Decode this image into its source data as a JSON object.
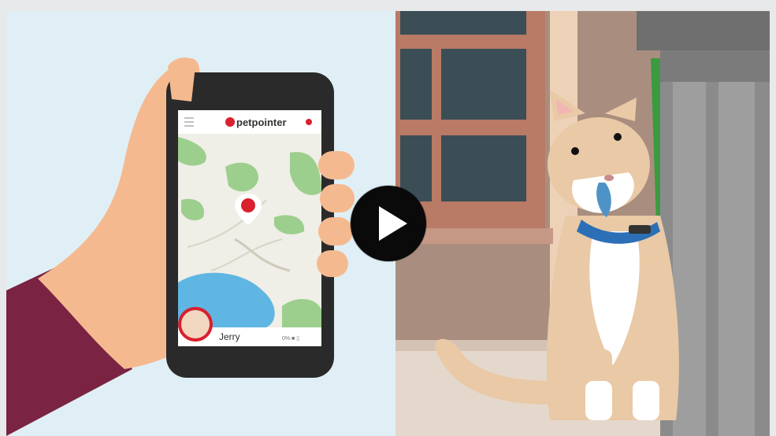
{
  "video": {
    "player_label": "Video player",
    "play_label": "Play video"
  },
  "app": {
    "brand": "petpointer",
    "pet_name": "Jerry",
    "battery_text": "0% ■ ▯"
  },
  "colors": {
    "sky": "#dcecf4",
    "phone_body": "#2a2a2a",
    "sleeve": "#7a2343",
    "skin": "#f5b98f",
    "brand_red": "#d9202e",
    "map_land": "#efeee7",
    "map_park": "#9ccf8d",
    "map_water": "#5fb6e2",
    "wall": "#a98e7f",
    "window_frame": "#b97a66",
    "window_glass": "#3b4e56",
    "cat_fur": "#e9c9a6",
    "collar": "#2c6fb6",
    "plant": "#3b9a3f",
    "door": "#8b8b8b"
  }
}
